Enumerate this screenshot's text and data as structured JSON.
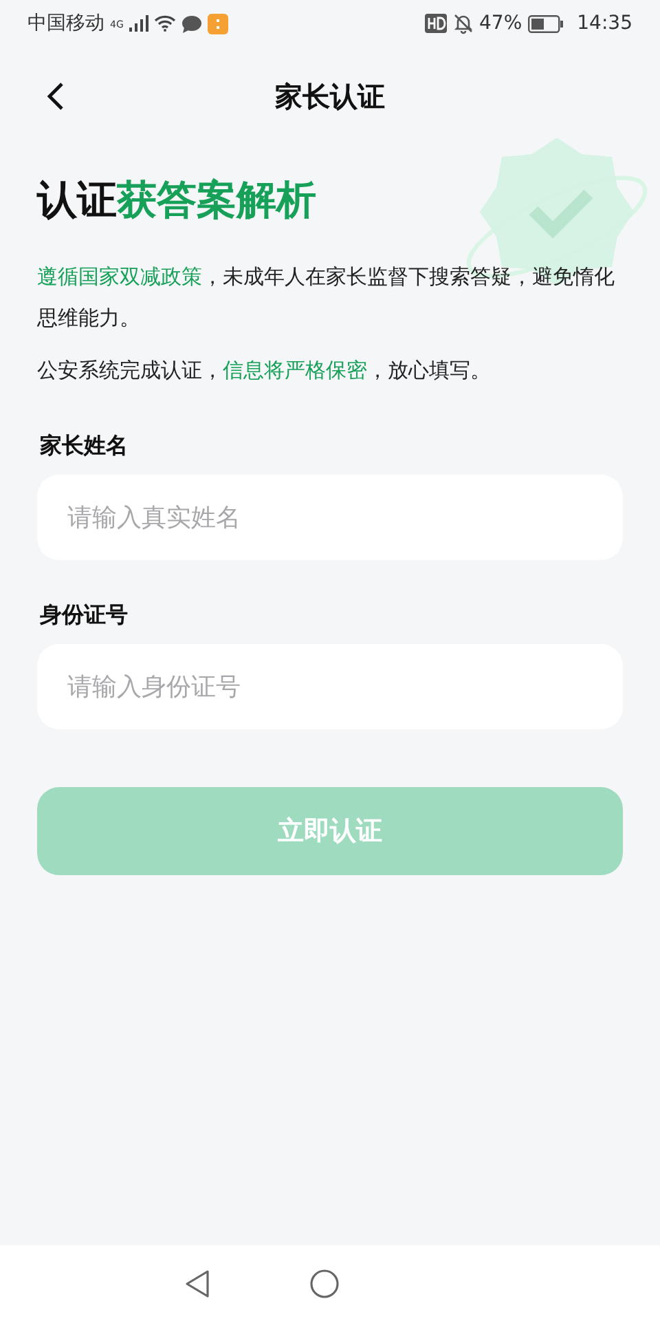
{
  "status_bar": {
    "carrier": "中国移动",
    "network": "4G",
    "battery": "47%",
    "time": "14:35"
  },
  "header": {
    "title": "家长认证"
  },
  "heading": [
    {
      "text": "认证",
      "highlight": false
    },
    {
      "text": "获答案解析",
      "highlight": true
    }
  ],
  "paragraphs": [
    [
      {
        "text": "遵循国家双减政策",
        "highlight": true
      },
      {
        "text": "，未成年人在家长监督下搜索答疑，避免惰化思维能力。",
        "highlight": false
      }
    ],
    [
      {
        "text": "公安系统完成认证，",
        "highlight": false
      },
      {
        "text": "信息将严格保密",
        "highlight": true
      },
      {
        "text": "，放心填写。",
        "highlight": false
      }
    ]
  ],
  "fields": [
    {
      "label": "家长姓名",
      "placeholder": "请输入真实姓名"
    },
    {
      "label": "身份证号",
      "placeholder": "请输入身份证号"
    }
  ],
  "submit": {
    "label": "立即认证",
    "disabled": true
  }
}
